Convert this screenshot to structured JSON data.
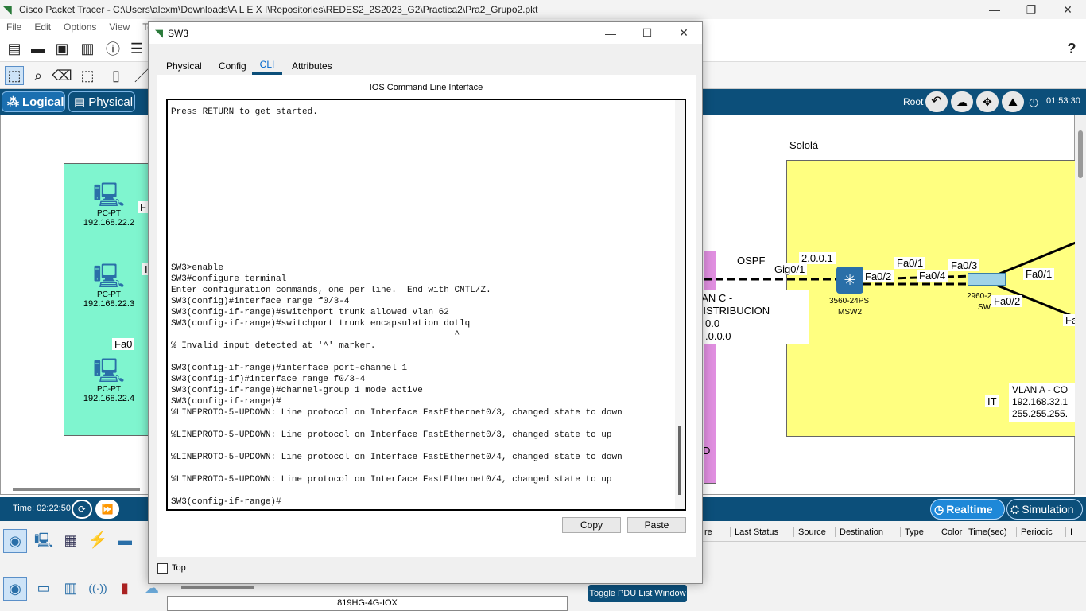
{
  "main_window": {
    "title": "Cisco Packet Tracer - C:\\Users\\alexm\\Downloads\\A L E X I\\Repositories\\REDES2_2S2023_G2\\Practica2\\Pra2_Grupo2.pkt",
    "minimize": "—",
    "maximize": "❐",
    "close": "✕"
  },
  "menu": [
    "File",
    "Edit",
    "Options",
    "View",
    "Too"
  ],
  "help": "?",
  "nav": {
    "logical": "Logical",
    "physical": "Physical",
    "root": "Root",
    "clock": "01:53:30"
  },
  "canvas": {
    "left_pcs": [
      {
        "model": "PC-PT",
        "ip": "192.168.22.2"
      },
      {
        "model": "PC-PT",
        "ip": "192.168.22.3"
      },
      {
        "model": "PC-PT",
        "ip": "192.168.22.4"
      }
    ],
    "left_labels": {
      "fa_top": "F",
      "fa_mid": "I",
      "fa_bottom": "Fa0"
    },
    "solola": "Sololá",
    "ospf": "OSPF",
    "ip_frag": "2.0.0.1",
    "gig": "Gig0/1",
    "msw_model": "3560-24PS",
    "msw_name": "MSW2",
    "fa02a": "Fa0/2",
    "fa01a": "Fa0/1",
    "fa04": "Fa0/4",
    "fa03": "Fa0/3",
    "sw_model": "2960-2",
    "sw_name": "SW",
    "fa01b": "Fa0/1",
    "fa02b": "Fa0/2",
    "fa_cut": "Fa",
    "vlan_c": [
      "LAN C - DISTRIBUCION",
      "0.0",
      ".0.0.0"
    ],
    "d_frag": "D",
    "it": "IT",
    "vlan_a": [
      "VLAN A - CO",
      "192.168.32.1",
      "255.255.255."
    ]
  },
  "timebar": {
    "time": "Time: 02:22:50",
    "realtime": "Realtime",
    "simulation": "Simulation"
  },
  "pdu_headers": [
    "re",
    "Last Status",
    "Source",
    "Destination",
    "Type",
    "Color",
    "Time(sec)",
    "Periodic",
    "I"
  ],
  "device_model": "819HG-4G-IOX",
  "toggle_pdu": "Toggle PDU List Window",
  "dialog": {
    "title": "SW3",
    "minimize": "—",
    "maximize": "☐",
    "close": "✕",
    "tabs": [
      "Physical",
      "Config",
      "CLI",
      "Attributes"
    ],
    "heading": "IOS Command Line Interface",
    "cli": "Press RETURN to get started.\n\n\n\n\n\n\n\n\n\n\n\n\n\nSW3>enable\nSW3#configure terminal\nEnter configuration commands, one per line.  End with CNTL/Z.\nSW3(config)#interface range f0/3-4\nSW3(config-if-range)#switchport trunk allowed vlan 62\nSW3(config-if-range)#switchport trunk encapsulation dotlq\n                                                      ^\n% Invalid input detected at '^' marker.\n\nSW3(config-if-range)#interface port-channel 1\nSW3(config-if)#interface range f0/3-4\nSW3(config-if-range)#channel-group 1 mode active\nSW3(config-if-range)#\n%LINEPROTO-5-UPDOWN: Line protocol on Interface FastEthernet0/3, changed state to down\n\n%LINEPROTO-5-UPDOWN: Line protocol on Interface FastEthernet0/3, changed state to up\n\n%LINEPROTO-5-UPDOWN: Line protocol on Interface FastEthernet0/4, changed state to down\n\n%LINEPROTO-5-UPDOWN: Line protocol on Interface FastEthernet0/4, changed state to up\n\nSW3(config-if-range)#",
    "copy": "Copy",
    "paste": "Paste",
    "top": "Top"
  },
  "colors": {
    "nav": "#0c4f7a",
    "green_area": "#7ff5cf",
    "yellow_area": "#ffff80",
    "pink_area": "#e08fe0",
    "pc_blue": "#2a6fa8"
  }
}
